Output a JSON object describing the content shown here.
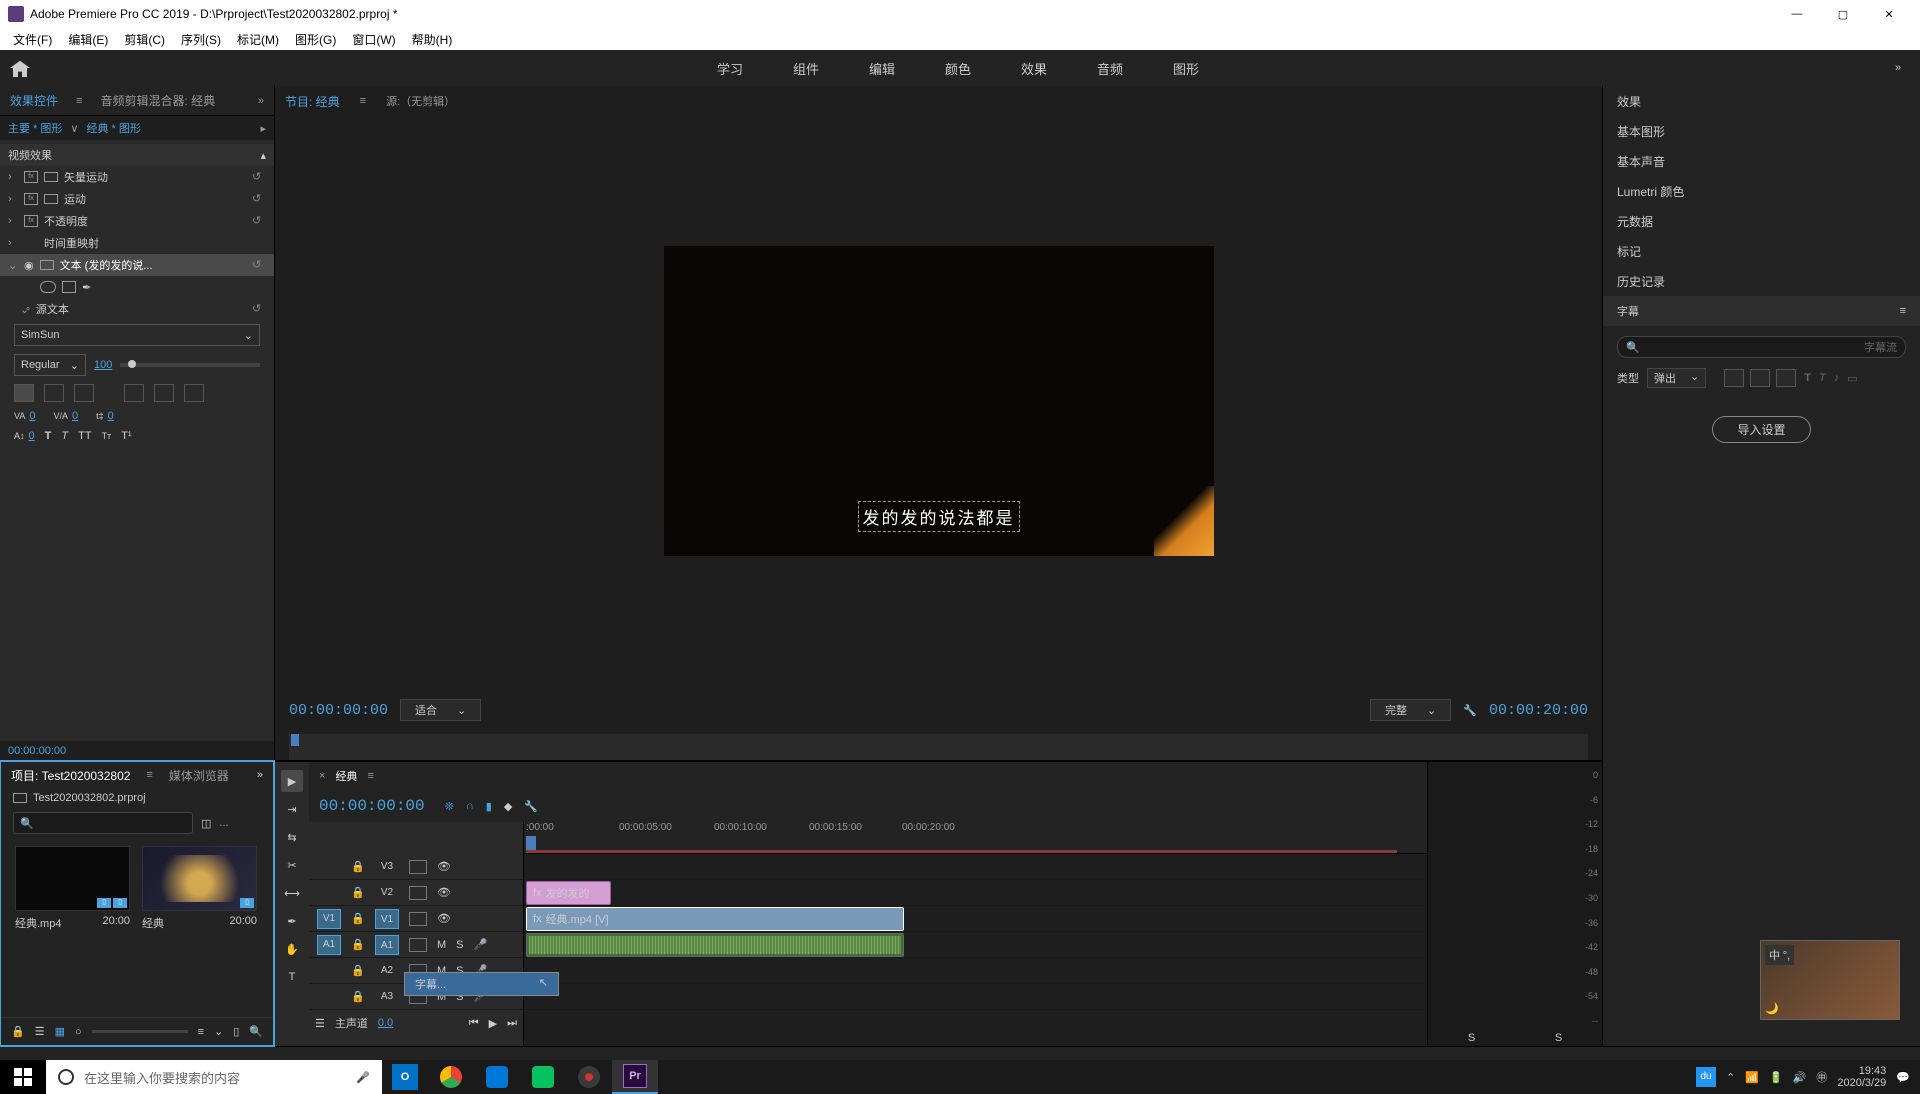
{
  "titlebar": {
    "app": "Adobe Premiere Pro CC 2019 - D:\\Prproject\\Test2020032802.prproj *"
  },
  "menubar": {
    "items": [
      "文件(F)",
      "编辑(E)",
      "剪辑(C)",
      "序列(S)",
      "标记(M)",
      "图形(G)",
      "窗口(W)",
      "帮助(H)"
    ]
  },
  "workspace": {
    "tabs": [
      "学习",
      "组件",
      "编辑",
      "颜色",
      "效果",
      "音频",
      "图形"
    ]
  },
  "ec_panel": {
    "tabs": {
      "fx": "效果控件",
      "mixer": "音频剪辑混合器: 经典"
    },
    "breadcrumb": {
      "master": "主要 * 图形",
      "seq": "经典 * 图形"
    },
    "section": "视频效果",
    "rows": [
      "矢量运动",
      "运动",
      "不透明度",
      "时间重映射",
      "文本 (发的发的说..."
    ],
    "source_text": "源文本",
    "font": "SimSun",
    "weight": "Regular",
    "size": "100",
    "tracking": "0",
    "kerning": "0",
    "leading": "0",
    "baseline": "0",
    "tc": "00:00:00:00"
  },
  "program": {
    "tab": "节目: 经典",
    "src": "源:（无剪辑）",
    "caption": "发的发的说法都是",
    "tc_in": "00:00:00:00",
    "fit": "适合",
    "quality": "完整",
    "tc_out": "00:00:20:00"
  },
  "project": {
    "tabs": {
      "proj": "项目: Test2020032802",
      "browser": "媒体浏览器"
    },
    "filename": "Test2020032802.prproj",
    "bins": [
      {
        "name": "经典.mp4",
        "dur": "20:00"
      },
      {
        "name": "经典",
        "dur": "20:00"
      }
    ]
  },
  "timeline": {
    "name": "经典",
    "tc": "00:00:00:00",
    "ticks": [
      ":00:00",
      "00:00:05:00",
      "00:00:10:00",
      "00:00:15:00",
      "00:00:20:00"
    ],
    "tracks": {
      "v3": "V3",
      "v2": "V2",
      "v1": "V1",
      "a1": "A1",
      "a2": "A2",
      "a3": "A3"
    },
    "src": {
      "v1": "V1",
      "a1": "A1"
    },
    "clips": {
      "graphic": "发的发的",
      "video": "经典.mp4 [V]"
    },
    "context": "字幕...",
    "master": "主声道",
    "master_val": "0.0"
  },
  "meters": {
    "levels": [
      "0",
      "-6",
      "-12",
      "-18",
      "-24",
      "-30",
      "-36",
      "-42",
      "-48",
      "-54",
      "--"
    ],
    "s": "S"
  },
  "right": {
    "items": [
      "效果",
      "基本图形",
      "基本声音",
      "Lumetri 颜色",
      "元数据",
      "标记",
      "历史记录",
      "字幕"
    ],
    "active": 7,
    "stream": "字幕流",
    "type": "类型",
    "popup": "弹出",
    "import": "导入设置"
  },
  "music": {
    "lang": "中",
    "mode": "°,"
  },
  "taskbar": {
    "search": "在这里输入你要搜索的内容",
    "time": "19:43",
    "date": "2020/3/29"
  }
}
